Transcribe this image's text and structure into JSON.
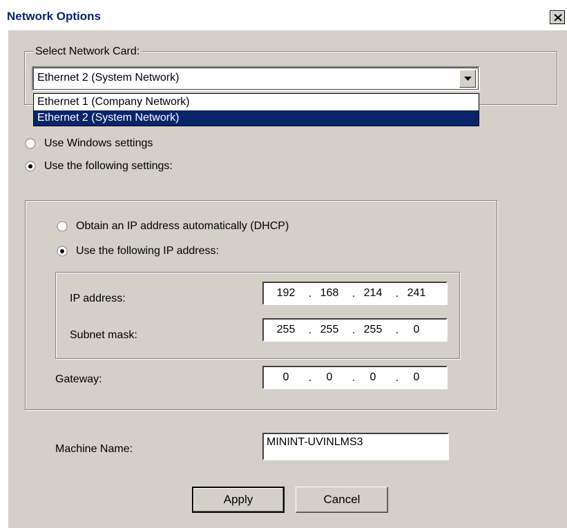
{
  "window": {
    "title": "Network Options"
  },
  "network_card": {
    "group_label": "Select Network Card:",
    "selected": "Ethernet 2 (System Network)",
    "options": [
      "Ethernet 1 (Company Network)",
      "Ethernet 2 (System Network)"
    ]
  },
  "settings_mode": {
    "windows_label": "Use Windows settings",
    "following_label": "Use the following settings:"
  },
  "ip_mode": {
    "dhcp_label": "Obtain an IP address automatically (DHCP)",
    "static_label": "Use the following IP address:"
  },
  "ip": {
    "ip_label": "IP address:",
    "ip_octets": [
      "192",
      "168",
      "214",
      "241"
    ],
    "subnet_label": "Subnet mask:",
    "subnet_octets": [
      "255",
      "255",
      "255",
      "0"
    ],
    "gateway_label": "Gateway:",
    "gateway_octets": [
      "0",
      "0",
      "0",
      "0"
    ],
    "separator": "."
  },
  "machine": {
    "label": "Machine Name:",
    "value": "MININT-UVINLMS3"
  },
  "buttons": {
    "apply": "Apply",
    "cancel": "Cancel"
  },
  "colors": {
    "face": "#d4d0c8",
    "selection": "#0a246a",
    "title_text": "#0a246a"
  }
}
